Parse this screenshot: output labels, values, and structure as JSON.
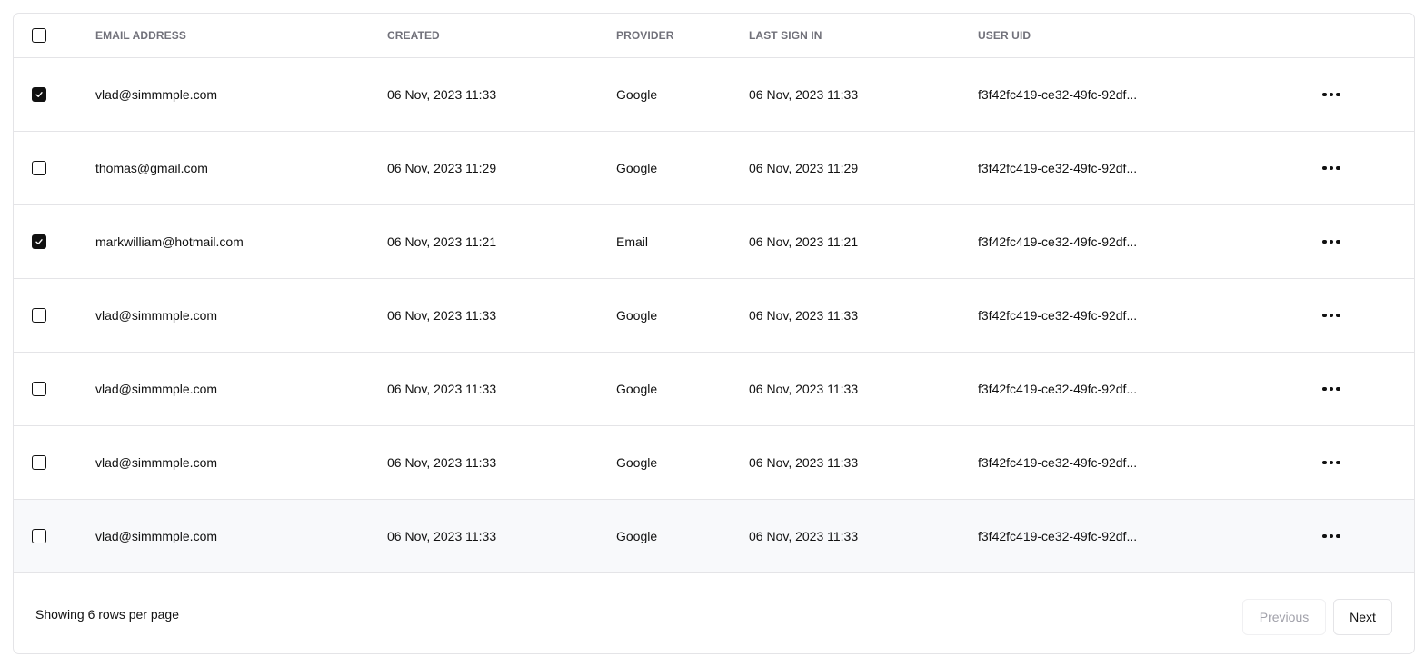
{
  "table": {
    "header": {
      "select_all_checked": false,
      "columns": {
        "email": "EMAIL ADDRESS",
        "created": "CREATED",
        "provider": "PROVIDER",
        "last_sign_in": "LAST SIGN IN",
        "user_uid": "USER UID"
      }
    },
    "rows": [
      {
        "checked": true,
        "email": "vlad@simmmple.com",
        "created": "06 Nov, 2023 11:33",
        "provider": "Google",
        "last_sign_in": "06 Nov, 2023 11:33",
        "user_uid": "f3f42fc419-ce32-49fc-92df...",
        "actions_icon": "more-horizontal-icon"
      },
      {
        "checked": false,
        "email": "thomas@gmail.com",
        "created": "06 Nov, 2023 11:29",
        "provider": "Google",
        "last_sign_in": "06 Nov, 2023 11:29",
        "user_uid": "f3f42fc419-ce32-49fc-92df...",
        "actions_icon": "more-horizontal-icon"
      },
      {
        "checked": true,
        "email": "markwilliam@hotmail.com",
        "created": "06 Nov, 2023 11:21",
        "provider": "Email",
        "last_sign_in": "06 Nov, 2023 11:21",
        "user_uid": "f3f42fc419-ce32-49fc-92df...",
        "actions_icon": "more-horizontal-icon"
      },
      {
        "checked": false,
        "email": "vlad@simmmple.com",
        "created": "06 Nov, 2023 11:33",
        "provider": "Google",
        "last_sign_in": "06 Nov, 2023 11:33",
        "user_uid": "f3f42fc419-ce32-49fc-92df...",
        "actions_icon": "more-horizontal-icon"
      },
      {
        "checked": false,
        "email": "vlad@simmmple.com",
        "created": "06 Nov, 2023 11:33",
        "provider": "Google",
        "last_sign_in": "06 Nov, 2023 11:33",
        "user_uid": "f3f42fc419-ce32-49fc-92df...",
        "actions_icon": "more-horizontal-icon"
      },
      {
        "checked": false,
        "email": "vlad@simmmple.com",
        "created": "06 Nov, 2023 11:33",
        "provider": "Google",
        "last_sign_in": "06 Nov, 2023 11:33",
        "user_uid": "f3f42fc419-ce32-49fc-92df...",
        "actions_icon": "more-horizontal-icon"
      },
      {
        "checked": false,
        "email": "vlad@simmmple.com",
        "created": "06 Nov, 2023 11:33",
        "provider": "Google",
        "last_sign_in": "06 Nov, 2023 11:33",
        "user_uid": "f3f42fc419-ce32-49fc-92df...",
        "actions_icon": "more-horizontal-icon",
        "hovered": true
      }
    ]
  },
  "footer": {
    "summary": "Showing 6 rows per page",
    "previous_label": "Previous",
    "previous_disabled": true,
    "next_label": "Next"
  }
}
